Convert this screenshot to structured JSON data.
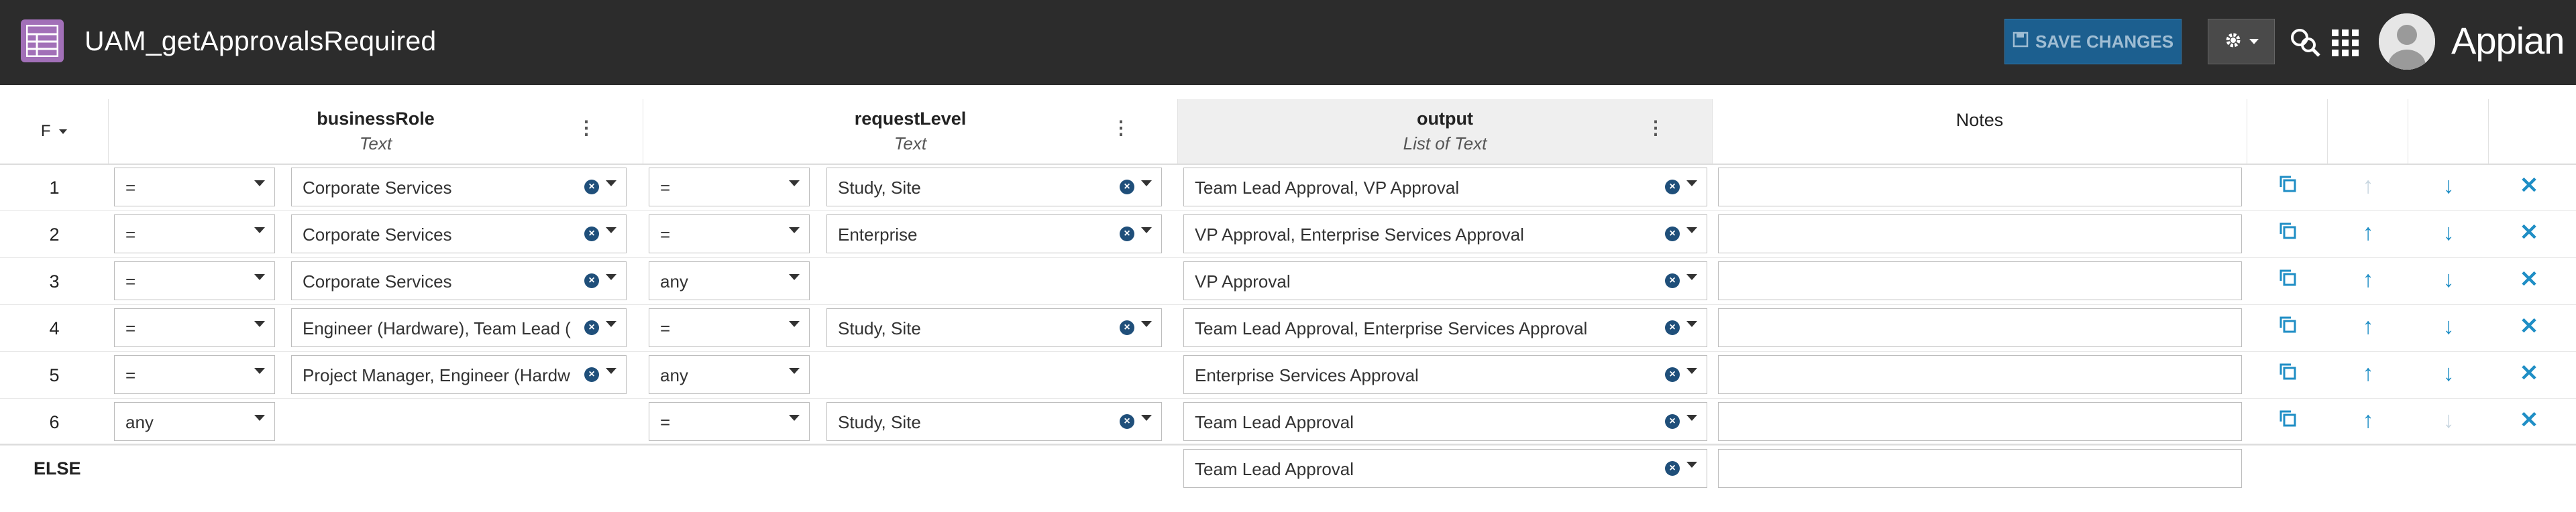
{
  "header": {
    "title": "UAM_getApprovalsRequired",
    "save_label": "SAVE CHANGES",
    "brand": "Appian"
  },
  "columns": {
    "hit_policy": "F",
    "business_role": {
      "name": "businessRole",
      "type": "Text"
    },
    "request_level": {
      "name": "requestLevel",
      "type": "Text"
    },
    "output": {
      "name": "output",
      "type": "List of Text"
    },
    "notes": "Notes",
    "menu_glyph": "⋮"
  },
  "rows": [
    {
      "num": "1",
      "br_op": "=",
      "br_val": "Corporate Services",
      "rl_op": "=",
      "rl_val": "Study, Site",
      "out": "Team Lead Approval, VP Approval"
    },
    {
      "num": "2",
      "br_op": "=",
      "br_val": "Corporate Services",
      "rl_op": "=",
      "rl_val": "Enterprise",
      "out": "VP Approval, Enterprise Services Approval"
    },
    {
      "num": "3",
      "br_op": "=",
      "br_val": "Corporate Services",
      "rl_op": "any",
      "rl_val": "",
      "out": "VP Approval"
    },
    {
      "num": "4",
      "br_op": "=",
      "br_val": "Engineer (Hardware), Team Lead (",
      "rl_op": "=",
      "rl_val": "Study, Site",
      "out": "Team Lead Approval, Enterprise Services Approval"
    },
    {
      "num": "5",
      "br_op": "=",
      "br_val": "Project Manager, Engineer (Hardw",
      "rl_op": "any",
      "rl_val": "",
      "out": "Enterprise Services Approval"
    },
    {
      "num": "6",
      "br_op": "any",
      "br_val": "",
      "rl_op": "=",
      "rl_val": "Study, Site",
      "out": "Team Lead Approval"
    }
  ],
  "else_row": {
    "label": "ELSE",
    "out": "Team Lead Approval"
  },
  "row_actions": {
    "up_enabled": [
      false,
      true,
      true,
      true,
      true,
      true
    ],
    "down_enabled": [
      true,
      true,
      true,
      true,
      true,
      false
    ]
  },
  "colors": {
    "header_bg": "#2c2c2c",
    "accent": "#1f8ec5",
    "app_icon": "#a270b8",
    "save_btn": "#1c5f8f"
  }
}
